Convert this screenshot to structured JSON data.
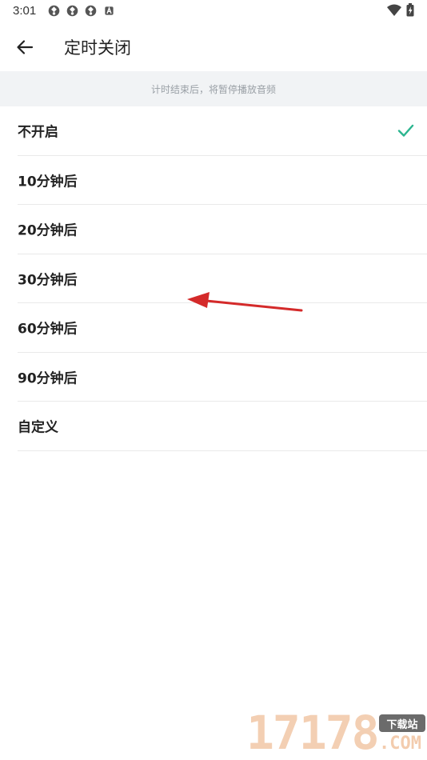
{
  "status_bar": {
    "time": "3:01",
    "left_icons": [
      "sync-icon",
      "sync-icon",
      "sync-icon",
      "a-icon"
    ],
    "right_icons": [
      "wifi-icon",
      "battery-icon"
    ]
  },
  "app_bar": {
    "back_icon": "arrow-left-icon",
    "title": "定时关闭"
  },
  "hint": {
    "text": "计时结束后，将暂停播放音频"
  },
  "options": [
    {
      "label": "不开启",
      "selected": true
    },
    {
      "label": "10分钟后",
      "selected": false
    },
    {
      "label": "20分钟后",
      "selected": false
    },
    {
      "label": "30分钟后",
      "selected": false
    },
    {
      "label": "60分钟后",
      "selected": false
    },
    {
      "label": "90分钟后",
      "selected": false
    },
    {
      "label": "自定义",
      "selected": false
    }
  ],
  "colors": {
    "accent": "#2bb58f",
    "hint_bg": "#f1f3f5",
    "annotation_arrow": "#d42a2a"
  },
  "watermark": {
    "digits": "17178",
    "badge": "下载站",
    "domain": ".COM"
  }
}
